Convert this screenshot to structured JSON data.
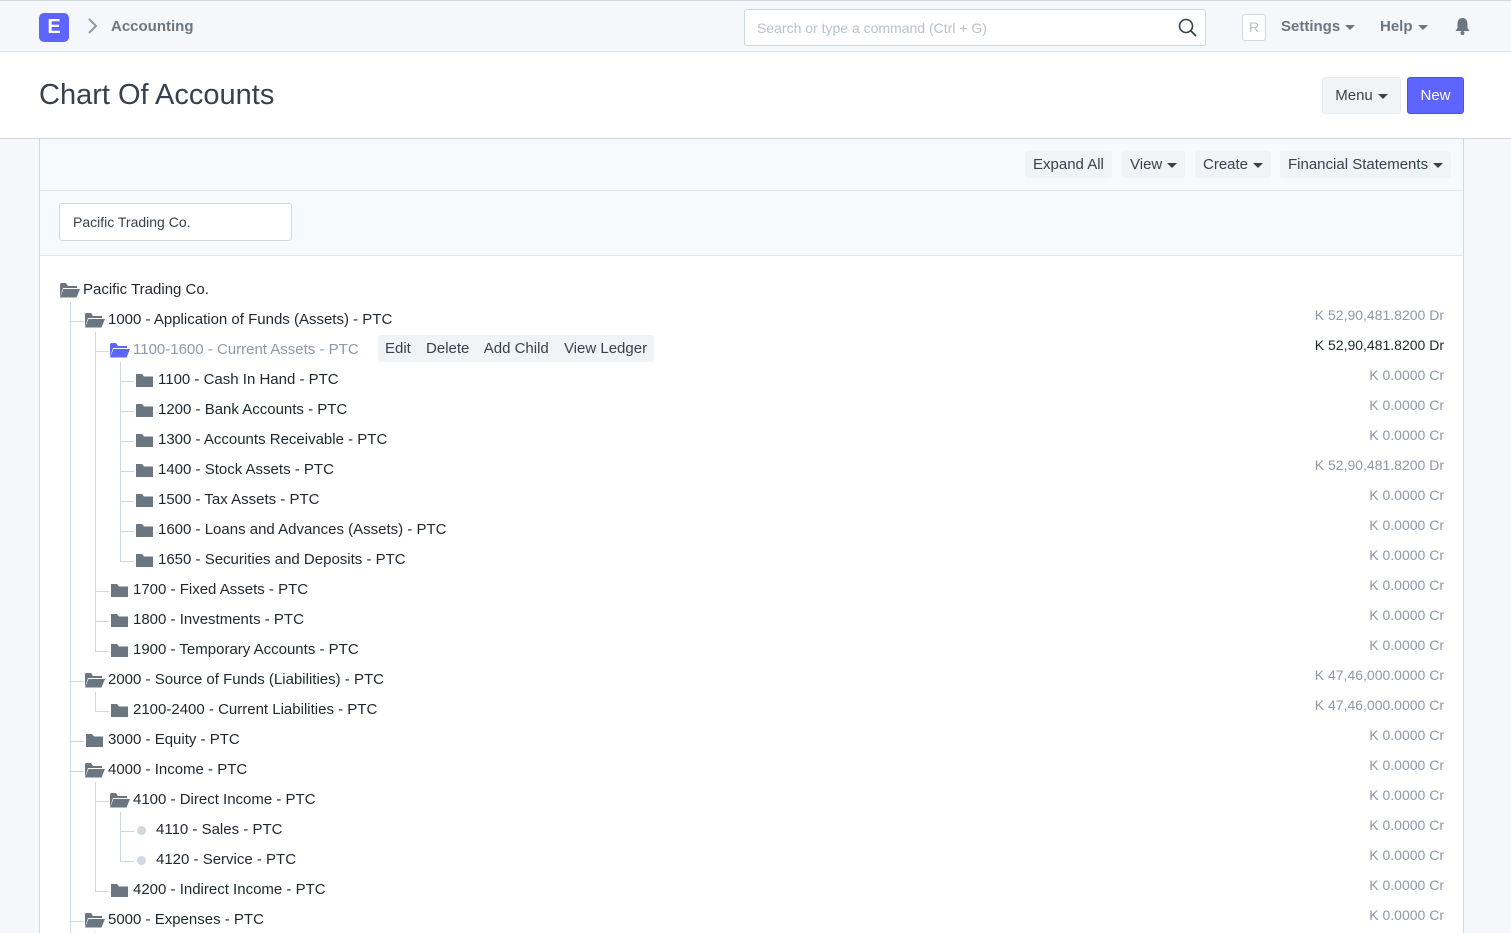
{
  "navbar": {
    "logo_letter": "E",
    "breadcrumb": "Accounting",
    "search_placeholder": "Search or type a command (Ctrl + G)",
    "avatar_letter": "R",
    "settings_label": "Settings",
    "help_label": "Help"
  },
  "page": {
    "title": "Chart Of Accounts",
    "menu_label": "Menu",
    "new_label": "New"
  },
  "toolbar": {
    "expand_all": "Expand All",
    "view": "View",
    "create": "Create",
    "financial_statements": "Financial Statements"
  },
  "filter": {
    "company": "Pacific Trading Co."
  },
  "row_actions": {
    "edit": "Edit",
    "delete": "Delete",
    "add_child": "Add Child",
    "view_ledger": "View Ledger"
  },
  "tree": {
    "root": "Pacific Trading Co.",
    "nodes": [
      {
        "label": "1000 - Application of Funds (Assets) - PTC",
        "balance": "K 52,90,481.8200 Dr"
      },
      {
        "label": "1100-1600 - Current Assets - PTC",
        "balance": "K 52,90,481.8200 Dr"
      },
      {
        "label": "1100 - Cash In Hand - PTC",
        "balance": "K 0.0000 Cr"
      },
      {
        "label": "1200 - Bank Accounts - PTC",
        "balance": "K 0.0000 Cr"
      },
      {
        "label": "1300 - Accounts Receivable - PTC",
        "balance": "K 0.0000 Cr"
      },
      {
        "label": "1400 - Stock Assets - PTC",
        "balance": "K 52,90,481.8200 Dr"
      },
      {
        "label": "1500 - Tax Assets - PTC",
        "balance": "K 0.0000 Cr"
      },
      {
        "label": "1600 - Loans and Advances (Assets) - PTC",
        "balance": "K 0.0000 Cr"
      },
      {
        "label": "1650 - Securities and Deposits - PTC",
        "balance": "K 0.0000 Cr"
      },
      {
        "label": "1700 - Fixed Assets - PTC",
        "balance": "K 0.0000 Cr"
      },
      {
        "label": "1800 - Investments - PTC",
        "balance": "K 0.0000 Cr"
      },
      {
        "label": "1900 - Temporary Accounts - PTC",
        "balance": "K 0.0000 Cr"
      },
      {
        "label": "2000 - Source of Funds (Liabilities) - PTC",
        "balance": "K 47,46,000.0000 Cr"
      },
      {
        "label": "2100-2400 - Current Liabilities - PTC",
        "balance": "K 47,46,000.0000 Cr"
      },
      {
        "label": "3000 - Equity - PTC",
        "balance": "K 0.0000 Cr"
      },
      {
        "label": "4000 - Income - PTC",
        "balance": "K 0.0000 Cr"
      },
      {
        "label": "4100 - Direct Income - PTC",
        "balance": "K 0.0000 Cr"
      },
      {
        "label": "4110 - Sales - PTC",
        "balance": "K 0.0000 Cr"
      },
      {
        "label": "4120 - Service - PTC",
        "balance": "K 0.0000 Cr"
      },
      {
        "label": "4200 - Indirect Income - PTC",
        "balance": "K 0.0000 Cr"
      },
      {
        "label": "5000 - Expenses - PTC",
        "balance": "K 0.0000 Cr"
      }
    ]
  },
  "colors": {
    "primary": "#5e64ff",
    "folder": "#6c7680",
    "muted": "#8d99a6"
  }
}
